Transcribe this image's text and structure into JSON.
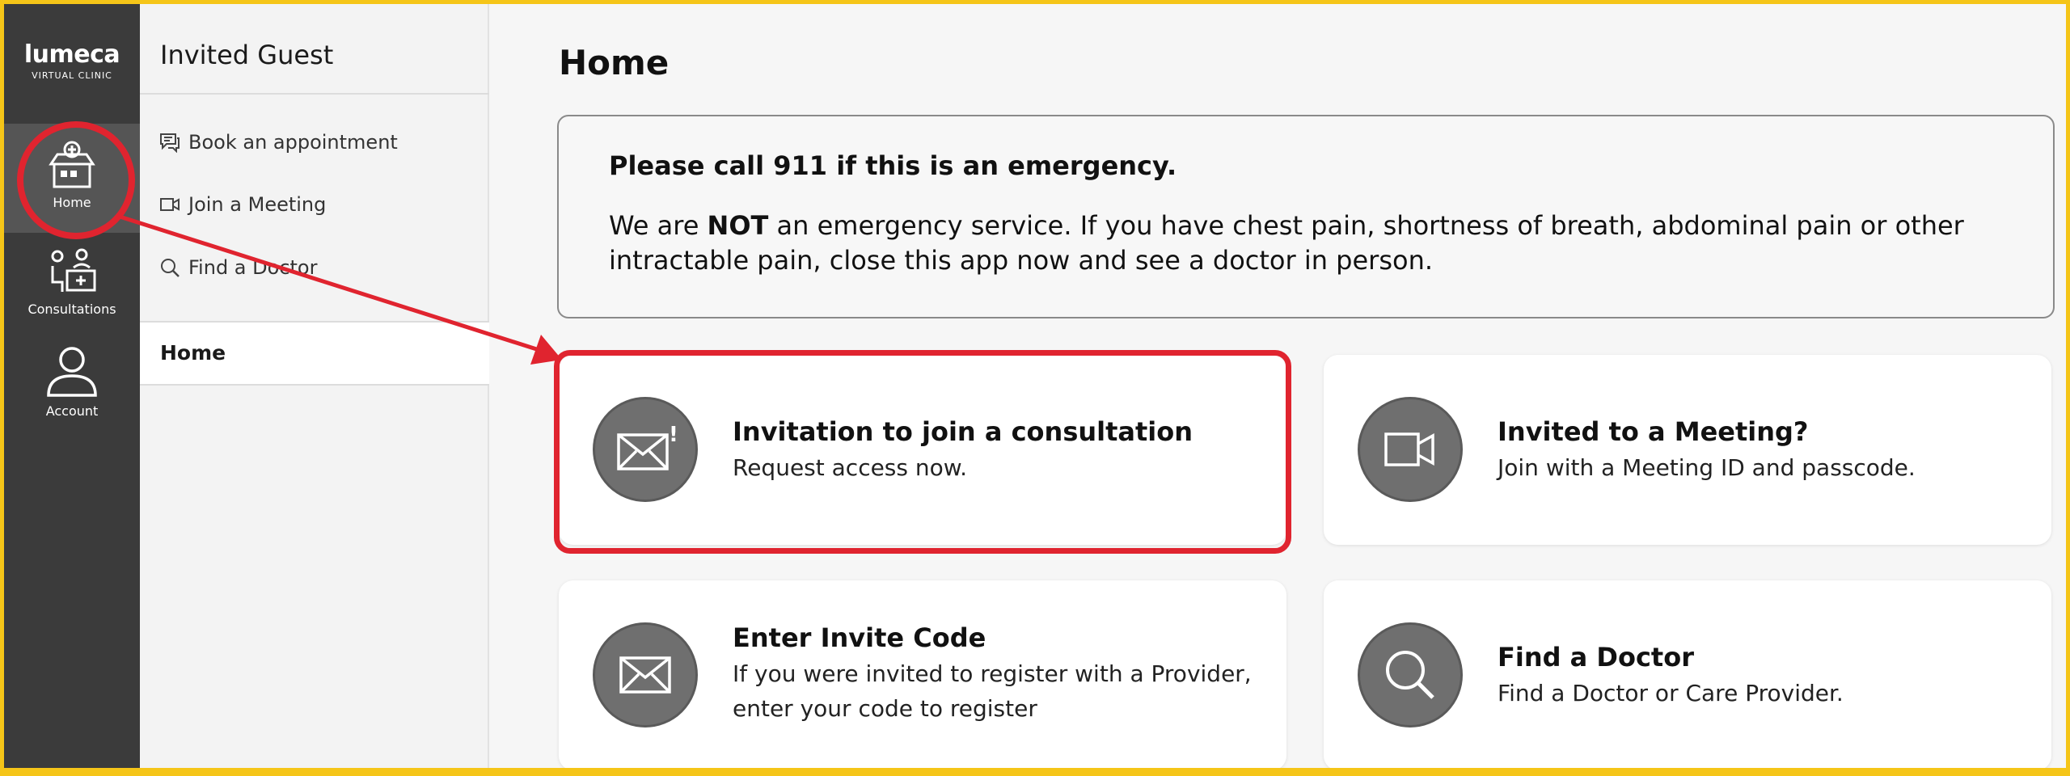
{
  "app": {
    "brand": "lumeca",
    "brand_sub": "VIRTUAL CLINIC"
  },
  "rail": {
    "items": [
      {
        "label": "Home",
        "icon": "home-icon"
      },
      {
        "label": "Consultations",
        "icon": "consultations-icon"
      },
      {
        "label": "Account",
        "icon": "account-icon"
      }
    ]
  },
  "menu": {
    "title": "Invited Guest",
    "links": [
      {
        "label": "Book an appointment",
        "icon": "chat-icon"
      },
      {
        "label": "Join a Meeting",
        "icon": "video-icon"
      },
      {
        "label": "Find a Doctor",
        "icon": "search-icon"
      }
    ],
    "active": "Home"
  },
  "main": {
    "title": "Home",
    "notice": {
      "title": "Please call 911 if this is an emergency.",
      "body_prefix": "We are ",
      "body_bold": "NOT",
      "body_suffix": " an emergency service. If you have chest pain, shortness of breath, abdominal pain or other intractable pain, close this app now and see a doctor in person."
    },
    "cards": [
      {
        "title": "Invitation to join a consultation",
        "subtitle": "Request access now.",
        "icon": "mail-alert-icon"
      },
      {
        "title": "Invited to a Meeting?",
        "subtitle": "Join with a Meeting ID and passcode.",
        "icon": "video-icon"
      },
      {
        "title": "Enter Invite Code",
        "subtitle": "If you were invited to register with a Provider, enter your code to register",
        "icon": "mail-icon"
      },
      {
        "title": "Find a Doctor",
        "subtitle": "Find a Doctor or Care Provider.",
        "icon": "search-icon"
      }
    ]
  },
  "colors": {
    "frame": "#f5c518",
    "rail": "#3b3b3b",
    "highlight": "#e0242f",
    "icon_circle": "#6f6f6f"
  }
}
